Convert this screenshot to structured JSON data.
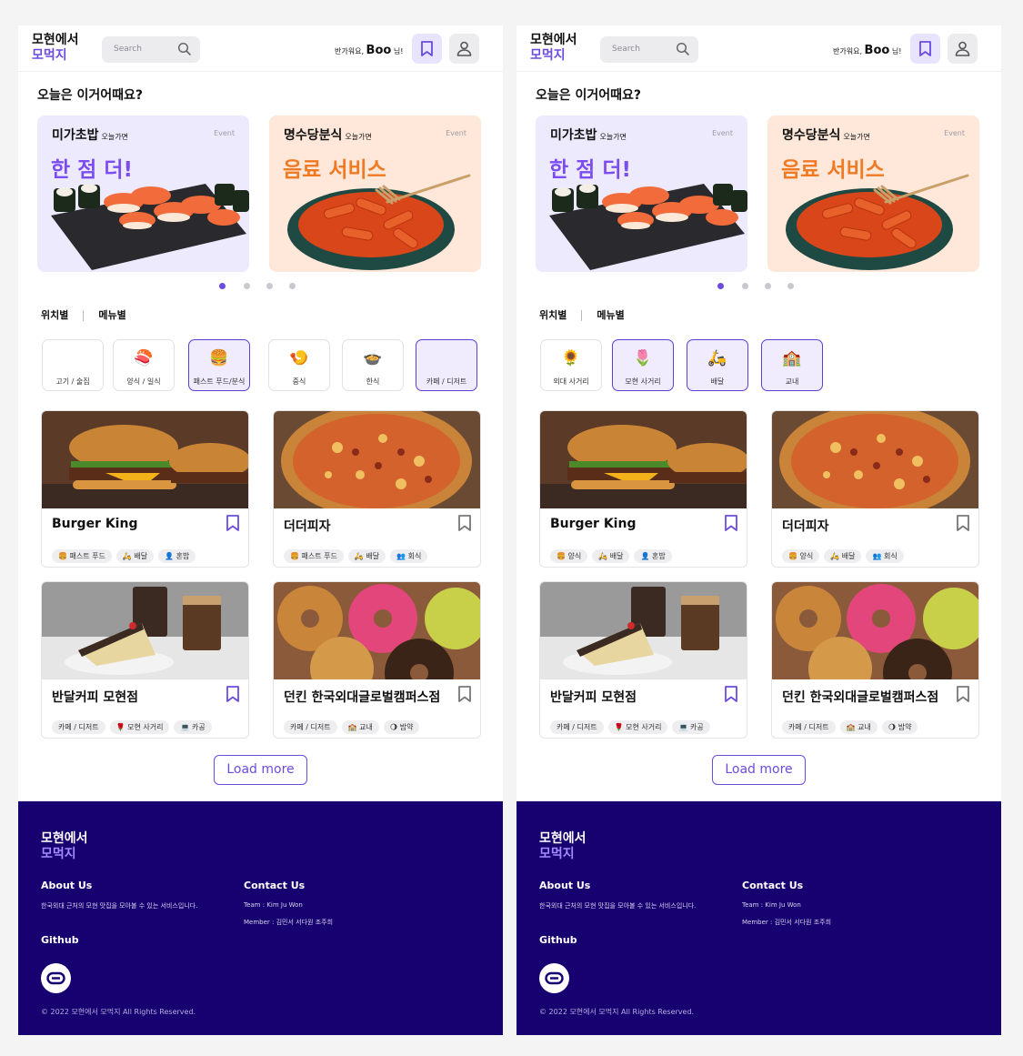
{
  "app": {
    "logo_line1": "모현에서",
    "logo_line2": "모먹지",
    "search_placeholder": "Search",
    "greeting_prefix": "반가워요,",
    "user_name": "Boo",
    "greeting_suffix": "님!",
    "accent_color": "#6c4bdf",
    "footer_bg": "#170070"
  },
  "headline": "오늘은 이거어때요?",
  "banners": [
    {
      "store": "미가초밥",
      "sub": "오늘가면",
      "tag": "Event",
      "promo": "한 점 더!",
      "image": "sushi-platter"
    },
    {
      "store": "명수당분식",
      "sub": "오늘가면",
      "tag": "Event",
      "promo": "음료 서비스",
      "image": "tteokbokki-bowl"
    }
  ],
  "carousel": {
    "count": 4,
    "active_index": 0
  },
  "category_tabs": {
    "location": "위치별",
    "menu": "메뉴별"
  },
  "screens": [
    {
      "chips": [
        {
          "icon": "meat-icon",
          "label": "고기 / 술집",
          "selected": false
        },
        {
          "icon": "sushi-icon",
          "label": "양식 / 일식",
          "selected": false
        },
        {
          "icon": "burger-icon",
          "label": "패스트 푸드/분식",
          "selected": true
        },
        {
          "icon": "shrimp-icon",
          "label": "중식",
          "selected": false
        },
        {
          "icon": "soup-icon",
          "label": "한식",
          "selected": false
        },
        {
          "icon": "cafe-icon",
          "label": "카페 / 디저트",
          "selected": true
        }
      ],
      "cards": [
        {
          "name": "Burger King",
          "image": "burger",
          "bookmarked": true,
          "tags": [
            "🍔 패스트 푸드",
            "🛵 배달",
            "👤 혼밥"
          ]
        },
        {
          "name": "더더피자",
          "image": "pizza",
          "bookmarked": false,
          "tags": [
            "🍔 패스트 푸드",
            "🛵 배달",
            "👥 회식"
          ]
        },
        {
          "name": "반달커피 모현점",
          "image": "cake-coffee",
          "bookmarked": true,
          "tags": [
            "카페 / 디저트",
            "🌹 모현 사거리",
            "💻 카공"
          ]
        },
        {
          "name": "던킨 한국외대글로벌캠퍼스점",
          "image": "donuts",
          "bookmarked": false,
          "tags": [
            "카페 / 디저트",
            "🏫 교내",
            "🌖 밤약"
          ]
        }
      ]
    },
    {
      "chips": [
        {
          "icon": "sunflower-icon",
          "label": "외대 사거리",
          "selected": false
        },
        {
          "icon": "tulip-icon",
          "label": "모현 사거리",
          "selected": true
        },
        {
          "icon": "scooter-icon",
          "label": "배달",
          "selected": true
        },
        {
          "icon": "school-icon",
          "label": "교내",
          "selected": true
        }
      ],
      "cards": [
        {
          "name": "Burger King",
          "image": "burger",
          "bookmarked": true,
          "tags": [
            "🍔 양식",
            "🛵 배달",
            "👤 혼밥"
          ]
        },
        {
          "name": "더더피자",
          "image": "pizza",
          "bookmarked": false,
          "tags": [
            "🍔 양식",
            "🛵 배달",
            "👥 회식"
          ]
        },
        {
          "name": "반달커피 모현점",
          "image": "cake-coffee",
          "bookmarked": true,
          "tags": [
            "카페 / 디저트",
            "🌹 모현 사거리",
            "💻 카공"
          ]
        },
        {
          "name": "던킨 한국외대글로벌캠퍼스점",
          "image": "donuts",
          "bookmarked": false,
          "tags": [
            "카페 / 디저트",
            "🏫 교내",
            "🌖 밤약"
          ]
        }
      ]
    }
  ],
  "load_more": "Load more",
  "footer": {
    "logo_line1": "모현에서",
    "logo_line2": "모먹지",
    "about_title": "About  Us",
    "about_text": "한국외대 근처의 모현 맛집을 모아볼 수 있는 서비스입니다.",
    "contact_title": "Contact Us",
    "team": "Team   :   Kim Ju Won",
    "member": "Member   :   김민서 서다원 조주희",
    "github_title": "Github",
    "github_icon": "link-icon",
    "copyright": "© 2022 모현에서 모먹지 All Rights Reserved."
  }
}
